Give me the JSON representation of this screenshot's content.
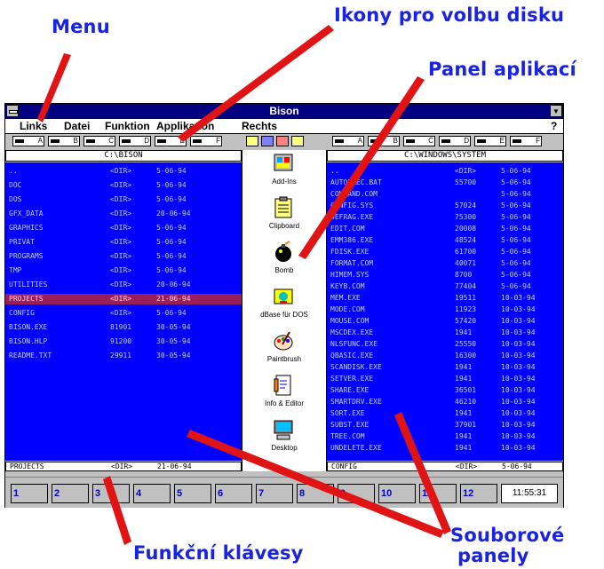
{
  "callouts": {
    "menu": "Menu",
    "drive_icons": "Ikony pro volbu disku",
    "app_panel": "Panel aplikací",
    "function_keys": "Funkční klávesy",
    "file_panels_1": "Souborové",
    "file_panels_2": "panely"
  },
  "window": {
    "title": "Bison",
    "menu": [
      "Links",
      "Datei",
      "Funktion",
      "Applikation",
      "Rechts",
      "?"
    ]
  },
  "drives": {
    "left": [
      "A",
      "B",
      "C",
      "D",
      "E",
      "F"
    ],
    "right": [
      "A",
      "B",
      "C",
      "D",
      "E",
      "F"
    ]
  },
  "left_panel": {
    "path": "C:\\BISON",
    "rows": [
      [
        "..",
        "<DIR>",
        "5-06-94"
      ],
      [
        "DOC",
        "<DIR>",
        "5-06-94"
      ],
      [
        "DOS",
        "<DIR>",
        "5-06-94"
      ],
      [
        "GFX_DATA",
        "<DIR>",
        "20-06-94"
      ],
      [
        "GRAPHICS",
        "<DIR>",
        "5-06-94"
      ],
      [
        "PRIVAT",
        "<DIR>",
        "5-06-94"
      ],
      [
        "PROGRAMS",
        "<DIR>",
        "5-06-94"
      ],
      [
        "TMP",
        "<DIR>",
        "5-06-94"
      ],
      [
        "UTILITIES",
        "<DIR>",
        "20-06-94"
      ],
      [
        "PROJECTS",
        "<DIR>",
        "21-06-94"
      ],
      [
        "CONFIG",
        "<DIR>",
        "5-06-94"
      ],
      [
        "BISON.EXE",
        "81901",
        "30-05-94"
      ],
      [
        "BISON.HLP",
        "91200",
        "30-05-94"
      ],
      [
        "README.TXT",
        "29911",
        "30-05-94"
      ]
    ],
    "selected_index": 9,
    "status": [
      "PROJECTS",
      "<DIR>",
      "21-06-94"
    ]
  },
  "right_panel": {
    "path": "C:\\WINDOWS\\SYSTEM",
    "rows": [
      [
        "..",
        "<DIR>",
        "5-06-94"
      ],
      [
        "AUTOEXEC.BAT",
        "",
        "55700",
        "5-06-94"
      ],
      [
        "COMMAND.COM",
        "",
        "",
        "5-06-94"
      ],
      [
        "CONFIG.SYS",
        "",
        "57024",
        "5-06-94"
      ],
      [
        "DEFRAG.EXE",
        "",
        "75300",
        "5-06-94"
      ],
      [
        "EDIT.COM",
        "",
        "20008",
        "5-06-94"
      ],
      [
        "EMM386.EXE",
        "",
        "48524",
        "5-06-94"
      ],
      [
        "FDISK.EXE",
        "",
        "61700",
        "5-06-94"
      ],
      [
        "FORMAT.COM",
        "",
        "40071",
        "5-06-94"
      ],
      [
        "HIMEM.SYS",
        "",
        "8700",
        "5-06-94"
      ],
      [
        "KEYB.COM",
        "",
        "77404",
        "5-06-94"
      ],
      [
        "MEM.EXE",
        "",
        "19511",
        "10-03-94"
      ],
      [
        "MODE.COM",
        "",
        "11923",
        "10-03-94"
      ],
      [
        "MOUSE.COM",
        "",
        "57420",
        "10-03-94"
      ],
      [
        "MSCDEX.EXE",
        "",
        "1941",
        "10-03-94"
      ],
      [
        "NLSFUNC.EXE",
        "",
        "25550",
        "10-03-94"
      ],
      [
        "QBASIC.EXE",
        "",
        "16300",
        "10-03-94"
      ],
      [
        "SCANDISK.EXE",
        "",
        "1941",
        "10-03-94"
      ],
      [
        "SETVER.EXE",
        "",
        "1941",
        "10-03-94"
      ],
      [
        "SHARE.EXE",
        "",
        "36501",
        "10-03-94"
      ],
      [
        "SMARTDRV.EXE",
        "",
        "46210",
        "10-03-94"
      ],
      [
        "SORT.EXE",
        "",
        "1941",
        "10-03-94"
      ],
      [
        "SUBST.EXE",
        "",
        "37901",
        "10-03-94"
      ],
      [
        "TREE.COM",
        "",
        "1941",
        "10-03-94"
      ],
      [
        "UNDELETE.EXE",
        "",
        "1941",
        "10-03-94"
      ]
    ],
    "status": [
      "CONFIG",
      "<DIR>",
      "5-06-94"
    ]
  },
  "apps": [
    {
      "label": "Add-Ins",
      "icon": "add-ins-icon"
    },
    {
      "label": "Clipboard",
      "icon": "clipboard-icon"
    },
    {
      "label": "Bomb",
      "icon": "bomb-icon"
    },
    {
      "label": "dBase für DOS",
      "icon": "dbase-icon"
    },
    {
      "label": "Paintbrush",
      "icon": "paintbrush-icon"
    },
    {
      "label": "Info & Editor",
      "icon": "info-editor-icon"
    },
    {
      "label": "Desktop",
      "icon": "desktop-icon"
    }
  ],
  "function_keys": [
    "1",
    "2",
    "3",
    "4",
    "5",
    "6",
    "7",
    "8",
    "9",
    "10",
    "11",
    "12"
  ],
  "clock": "11:55:31",
  "colors": {
    "callout": "#1a23e0",
    "arrow": "#e01414",
    "panel_bg": "#0000ff",
    "selection": "#9a1e5c",
    "titlebar": "#000080"
  }
}
